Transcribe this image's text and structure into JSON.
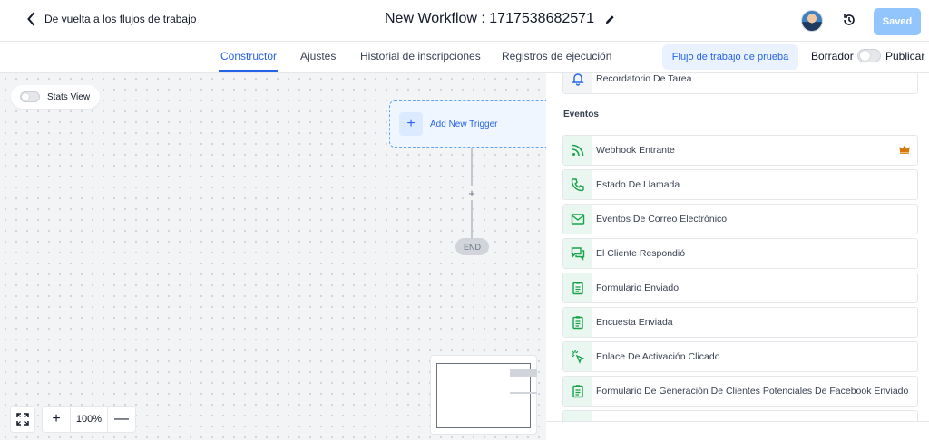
{
  "header": {
    "back_label": "De vuelta a los flujos de trabajo",
    "workflow_title": "New Workflow : 1717538682571",
    "saved_label": "Saved"
  },
  "tabs": [
    {
      "label": "Constructor",
      "active": true
    },
    {
      "label": "Ajustes",
      "active": false
    },
    {
      "label": "Historial de inscripciones",
      "active": false
    },
    {
      "label": "Registros de ejecución",
      "active": false
    }
  ],
  "actions": {
    "test_label": "Flujo de trabajo de prueba",
    "draft_label": "Borrador",
    "publish_label": "Publicar",
    "published": false
  },
  "canvas": {
    "stats_view_label": "Stats View",
    "add_trigger_label": "Add New Trigger",
    "end_label": "END",
    "zoom_label": "100%",
    "add_step_symbol": "+",
    "zoom_in_symbol": "+",
    "zoom_out_symbol": "—"
  },
  "panel": {
    "top_item": {
      "label": "Recordatorio De Tarea",
      "icon": "bell-icon"
    },
    "section_title": "Eventos",
    "items": [
      {
        "label": "Webhook Entrante",
        "icon": "rss-icon",
        "premium": true
      },
      {
        "label": "Estado De Llamada",
        "icon": "phone-icon"
      },
      {
        "label": "Eventos De Correo Electrónico",
        "icon": "mail-icon"
      },
      {
        "label": "El Cliente Respondió",
        "icon": "chat-icon"
      },
      {
        "label": "Formulario Enviado",
        "icon": "clipboard-icon"
      },
      {
        "label": "Encuesta Enviada",
        "icon": "clipboard-icon"
      },
      {
        "label": "Enlace De Activación Clicado",
        "icon": "cursor-click-icon"
      },
      {
        "label": "Formulario De Generación De Clientes Potenciales De Facebook Enviado",
        "icon": "clipboard-icon"
      }
    ]
  },
  "colors": {
    "accent": "#2563eb",
    "saved_button": "#93c5fd",
    "event_icon": "#16a34a",
    "premium_crown": "#d97706"
  }
}
